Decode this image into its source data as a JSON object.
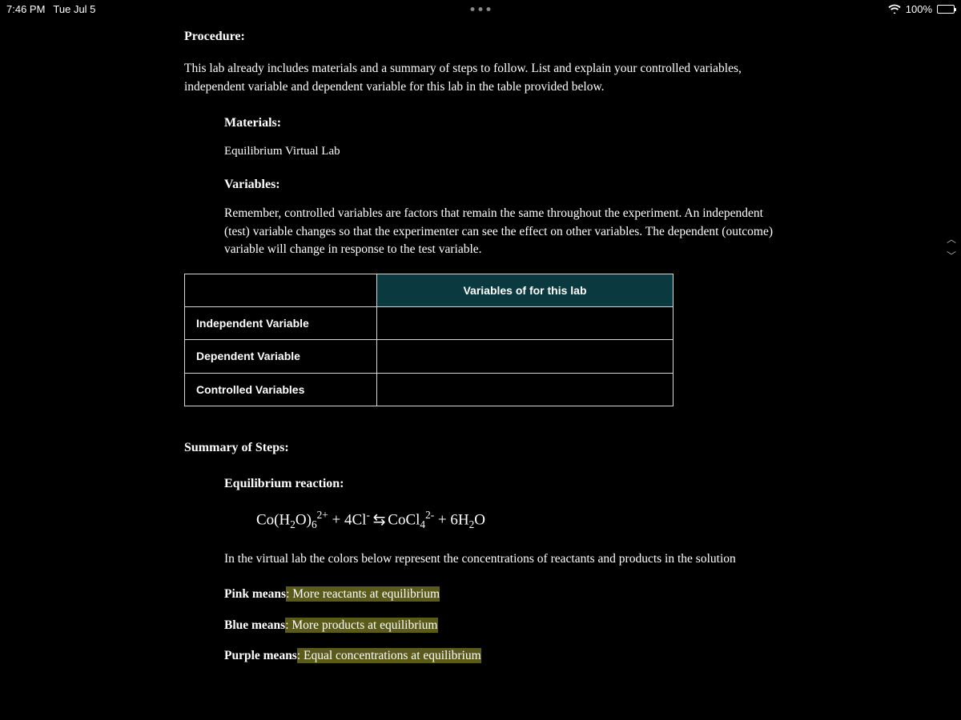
{
  "status": {
    "time": "7:46 PM",
    "date": "Tue Jul 5",
    "battery_pct": "100%"
  },
  "doc": {
    "procedure_heading": "Procedure:",
    "procedure_text": "This lab already includes materials and a summary of steps to follow. List and explain your controlled variables, independent variable and dependent variable for this lab in the table provided below.",
    "materials_heading": "Materials:",
    "materials_value": "Equilibrium Virtual Lab",
    "variables_heading": "Variables:",
    "variables_text": "Remember, controlled variables are factors that remain the same throughout the experiment. An independent (test) variable changes so that the experimenter can see the effect on other variables. The dependent (outcome) variable will change in response to the test variable.",
    "table": {
      "header_right": "Variables of for this lab",
      "rows": [
        {
          "label": "Independent Variable",
          "value": ""
        },
        {
          "label": "Dependent Variable",
          "value": ""
        },
        {
          "label": "Controlled Variables",
          "value": ""
        }
      ]
    },
    "summary_heading": "Summary of Steps:",
    "equilibrium_heading": "Equilibrium reaction:",
    "intro_colors": "In the virtual lab the colors below represent the concentrations of reactants and products in the solution",
    "pink_label": "Pink means",
    "pink_value": ": More reactants at equilibrium",
    "blue_label": "Blue means",
    "blue_value": ": More products at equilibrium",
    "purple_label": "Purple means",
    "purple_value": ": Equal concentrations at equilibrium"
  },
  "equation": {
    "lhs1_base": "Co(H",
    "lhs1_sub1": "2",
    "lhs1_mid": "O)",
    "lhs1_sub2": "6",
    "lhs1_sup": "2+",
    "plus1": "  + 4Cl",
    "cl_sup": "-",
    "arrow": " ⇆ ",
    "rhs1_base": " CoCl",
    "rhs1_sub": "4",
    "rhs1_sup": "2-",
    "plus2": " +  6H",
    "h2o_sub": "2",
    "h2o_end": "O"
  }
}
